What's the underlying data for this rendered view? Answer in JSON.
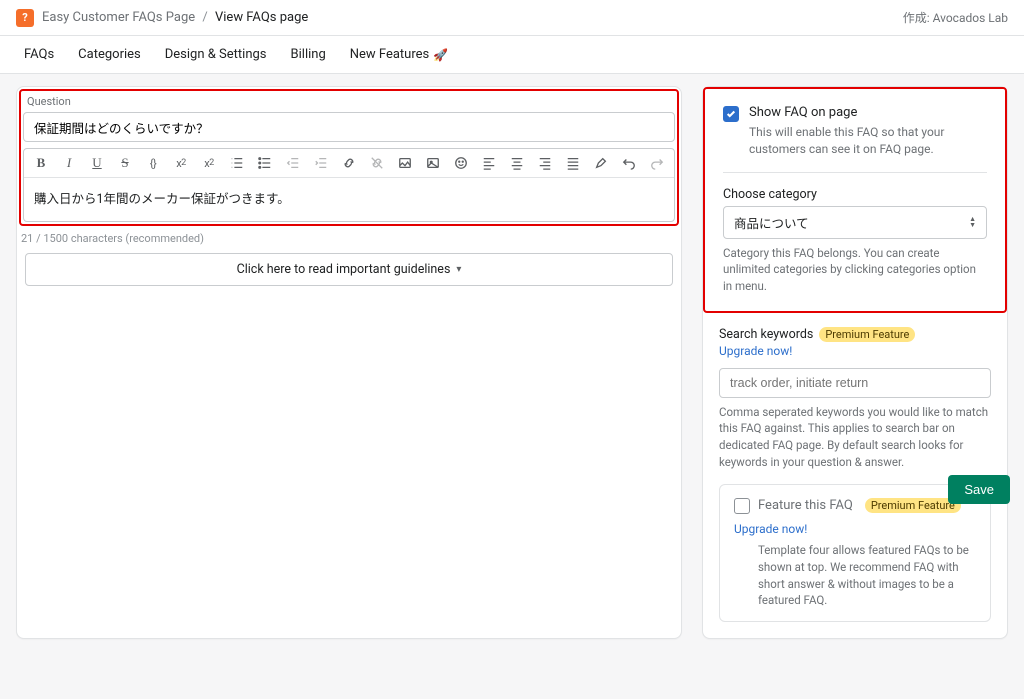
{
  "topbar": {
    "app_name": "Easy Customer FAQs Page",
    "separator": "/",
    "page_name": "View FAQs page",
    "credit": "作成: Avocados Lab"
  },
  "tabs": [
    "FAQs",
    "Categories",
    "Design & Settings",
    "Billing",
    "New Features"
  ],
  "question": {
    "label": "Question",
    "value": "保証期間はどのくらいですか？"
  },
  "answer": {
    "body": "購入日から1年間のメーカー保証がつきます。"
  },
  "char_count": "21 / 1500 characters (recommended)",
  "guidelines_label": "Click here to read important guidelines",
  "show_on_page": {
    "label": "Show FAQ on page",
    "help": "This will enable this FAQ so that your customers can see it on FAQ page."
  },
  "category": {
    "label": "Choose category",
    "value": "商品について",
    "help": "Category this FAQ belongs. You can create unlimited categories by clicking categories option in menu."
  },
  "search": {
    "label": "Search keywords",
    "badge": "Premium Feature",
    "upgrade": "Upgrade now!",
    "placeholder": "track order, initiate return",
    "help": "Comma seperated keywords you would like to match this FAQ against. This applies to search bar on dedicated FAQ page. By default search looks for keywords in your question & answer."
  },
  "feature": {
    "label": "Feature this FAQ",
    "badge": "Premium Feature",
    "upgrade": "Upgrade now!",
    "help": "Template four allows featured FAQs to be shown at top. We recommend FAQ with short answer & without images to be a featured FAQ."
  },
  "save_label": "Save",
  "toolbar_icons": [
    "bold",
    "italic",
    "underline",
    "strike",
    "code-braces",
    "superscript",
    "subscript",
    "ordered-list",
    "unordered-list",
    "outdent",
    "indent",
    "link",
    "unlink",
    "image-frame",
    "image",
    "emoji",
    "align-left",
    "align-center",
    "align-right",
    "align-justify",
    "highlighter",
    "undo",
    "redo"
  ]
}
